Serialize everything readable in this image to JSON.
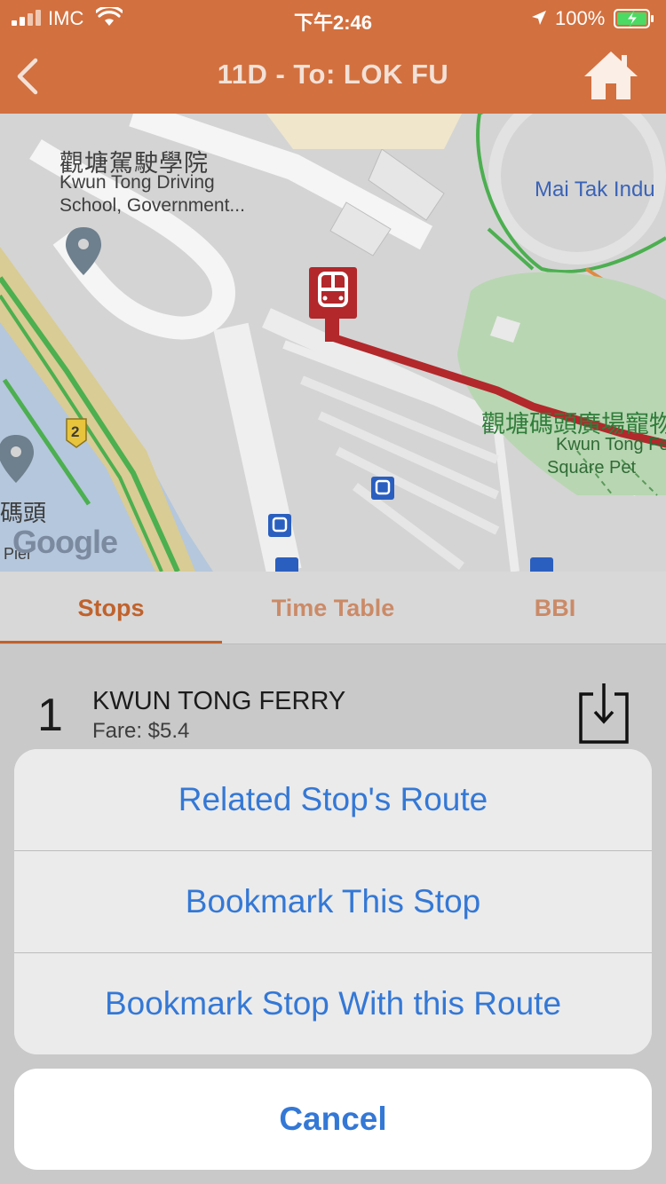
{
  "status_bar": {
    "carrier": "IMC",
    "time": "下午2:46",
    "battery": "100%"
  },
  "nav": {
    "title": "11D - To: LOK FU"
  },
  "map": {
    "school_zh": "觀塘駕駛學院",
    "school_en_line1": "Kwun Tong Driving",
    "school_en_line2": "School, Government...",
    "mai_tak": "Mai Tak Indu",
    "square_zh": "觀塘碼頭廣場寵物",
    "square_en_line1": "Kwun Tong Fe",
    "square_en_line2": "Square Pet",
    "pier_zh": "碼頭",
    "pier_en": "Pier",
    "google": "Google",
    "road_shield": "2"
  },
  "tabs": [
    {
      "label": "Stops"
    },
    {
      "label": "Time Table"
    },
    {
      "label": "BBI"
    }
  ],
  "stop": {
    "number": "1",
    "name": "KWUN TONG FERRY",
    "fare": "Fare: $5.4"
  },
  "action_sheet": {
    "options": [
      {
        "label": "Related Stop's Route"
      },
      {
        "label": "Bookmark This Stop"
      },
      {
        "label": "Bookmark Stop With this Route"
      }
    ],
    "cancel": "Cancel"
  },
  "colors": {
    "header": "#d2703f",
    "accent": "#c0622c",
    "action_blue": "#3478d6",
    "route_line": "#b2282b"
  }
}
